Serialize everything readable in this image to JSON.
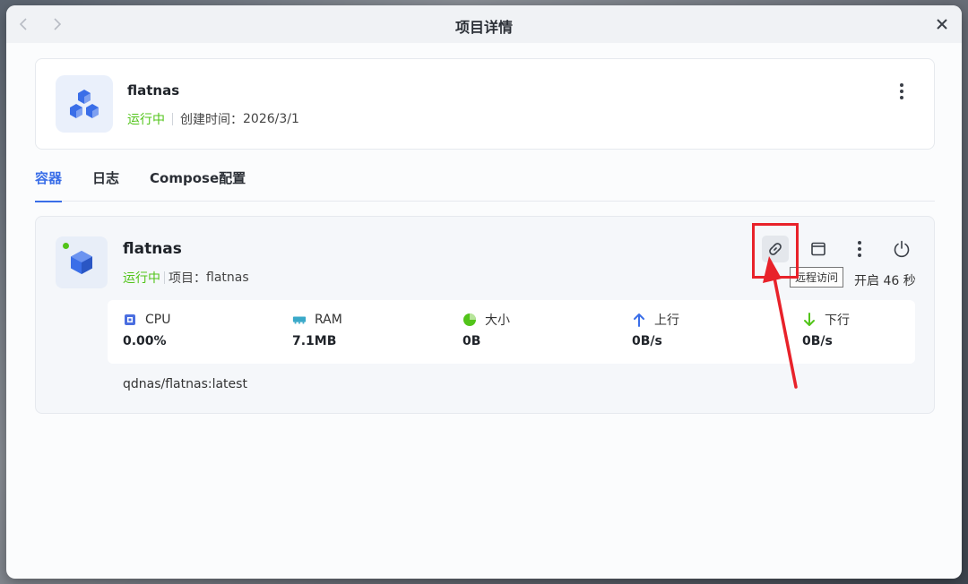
{
  "window": {
    "title": "项目详情"
  },
  "icons": {
    "back": "chevron-left-icon",
    "forward": "chevron-right-icon",
    "close": "close-icon"
  },
  "colors": {
    "accent": "#3a6ee8",
    "running": "#52c41a",
    "highlight": "#e8222a"
  },
  "project": {
    "name": "flatnas",
    "status": "运行中",
    "created_label": "创建时间：",
    "created_value": "2026/3/1"
  },
  "tabs": [
    {
      "label": "容器",
      "active": true
    },
    {
      "label": "日志",
      "active": false
    },
    {
      "label": "Compose配置",
      "active": false
    }
  ],
  "container": {
    "name": "flatnas",
    "status": "运行中",
    "project_label": "项目：",
    "project_value": "flatnas",
    "tooltip": "远程访问",
    "uptime": "开启 46 秒",
    "image": "qdnas/flatnas:latest",
    "stats": [
      {
        "label": "CPU",
        "value": "0.00%",
        "icon": "cpu-chip-icon"
      },
      {
        "label": "RAM",
        "value": "7.1MB",
        "icon": "memory-icon"
      },
      {
        "label": "大小",
        "value": "0B",
        "icon": "pie-chart-icon"
      },
      {
        "label": "上行",
        "value": "0B/s",
        "icon": "arrow-up-icon"
      },
      {
        "label": "下行",
        "value": "0B/s",
        "icon": "arrow-down-icon"
      }
    ]
  }
}
